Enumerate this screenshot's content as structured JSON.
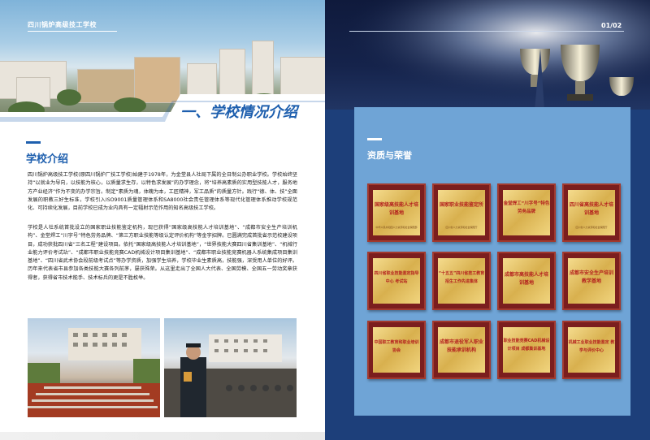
{
  "left_page": {
    "school_header": "四川锅炉高级技工学校",
    "section_title": "一、学校情况介绍",
    "intro_heading": "学校介绍",
    "paragraph_1": "四川锅炉高级技工学校(原四川锅炉厂技工学校)始建于1978年，为金堂县人社局下属的全日制公办职业学校。学校始终坚持“以就业为导向，以技能为核心，以质量求生存，以特色求发展”的办学理念，将“培养高素质的实用型技能人才，服务地方产业经济”作为不变的办学宗旨。制定“素质为魂，体魄为本，工匠精神，军工品质”的质量方针。践行“德、体、技”全面发展的职教三好生标准，学校引入ISO9001质量管理体系和SA8000社会责任管理体系等现代化管理体系推动学校规范化、可持续化发展，目前学校已成为业内具有一定辐射示范作用的知名高级技工学校。",
    "paragraph_2": "学校是人社系统首批设立的国家职业技能鉴定机构，现已获得“国家级高技能人才培训基地”、“成都市安全生产培训机构”、金堂焊工“川字号”特色劳务品牌、“第三方职业技能等级认定评价机构”等金字招牌。已圆满完成首批省示范校建设项目，成功获批四川省“三名工程”建设项目。依托“国家级高技能人才培训基地”，“世界技能大赛四川省集训基地”、“机械行业能力评价考试站”、“成都市职业技能竞赛CAD机械设计项目集训基地”、“成都市职业技能竞赛机器人系统集成项目集训基地”、“四川省武术协会段前级考试点”等办学资质，加强学生培养，学校毕业生素质高，技能强，深受用人单位的好评。历年来代表省市县参加各类技能大赛各列前茅，屡获殊荣。从这里走出了全国人大代表、全国劳模、全国五一劳动奖章获得者，获得省市技术能手、技术标兵的更是不胜枚举。"
  },
  "right_page": {
    "page_number": "01/02",
    "honors_heading": "资质与荣誉",
    "plaques": [
      {
        "title": "国家级高技能人才培训基地",
        "issuer": "中华人民共和国人力资源和社会保障部"
      },
      {
        "title": "国家职业技能鉴定所",
        "issuer": "四川省人力资源和社会保障厅"
      },
      {
        "title": "金堂焊工“川字号”特色劳务品牌",
        "issuer": ""
      },
      {
        "title": "四川省高技能人才培训基地",
        "issuer": "四川省人力资源和社会保障厅"
      },
      {
        "title": "四川省职业技能鉴定指导中心 考试站",
        "issuer": ""
      },
      {
        "title": "“十五五”四川省技工教育 招生工作先进集体",
        "issuer": ""
      },
      {
        "title": "成都市高技能人才培训基地",
        "issuer": ""
      },
      {
        "title": "成都市安全生产培训 教学基地",
        "issuer": ""
      },
      {
        "title": "中国职工教育和职业培训协会",
        "issuer": ""
      },
      {
        "title": "成都市退役军人职业技能承训机构",
        "issuer": ""
      },
      {
        "title": "职业技能竞赛CAD机械设计项目 成都集训基地",
        "issuer": ""
      },
      {
        "title": "机械工业职业技能鉴定 教学与评价中心",
        "issuer": ""
      }
    ]
  },
  "colors": {
    "brand_blue": "#1e5fae",
    "right_bg": "#1d3f7a",
    "panel_blue": "#6fa4d6",
    "plaque_red": "#7b1e1e",
    "plaque_gold": "#d8b04e"
  }
}
